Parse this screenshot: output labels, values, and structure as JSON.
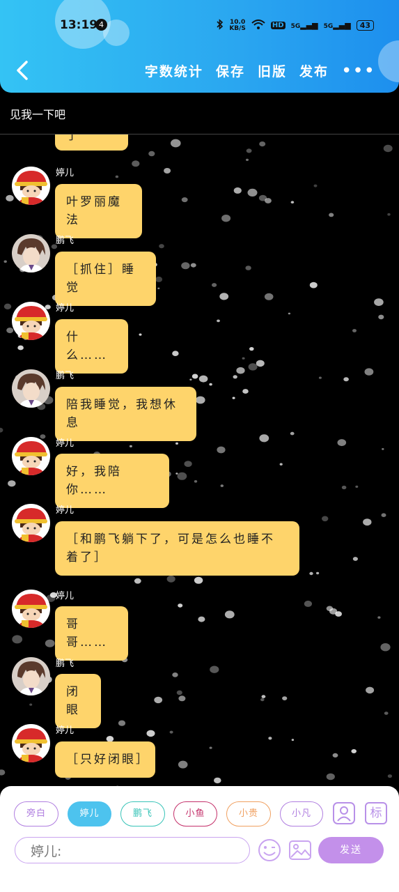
{
  "status_bar": {
    "time": "13:19",
    "notification_count": "4",
    "network_speed": "10.0\nKB/S",
    "hd_label": "HD",
    "signal_1": "5G",
    "signal_2": "5G",
    "battery": "43"
  },
  "header": {
    "actions": [
      "字数统计",
      "保存",
      "旧版",
      "发布"
    ],
    "more": "•••"
  },
  "title": "见我一下吧",
  "messages": [
    {
      "sender": "",
      "text": "别管我了",
      "avatar": "tinger"
    },
    {
      "sender": "婷儿",
      "text": "叶罗丽魔法",
      "avatar": "tinger"
    },
    {
      "sender": "鹏飞",
      "text": "［抓住］睡觉",
      "avatar": "pengfei"
    },
    {
      "sender": "婷儿",
      "text": "什么……",
      "avatar": "tinger"
    },
    {
      "sender": "鹏飞",
      "text": "陪我睡觉，我想休息",
      "avatar": "pengfei"
    },
    {
      "sender": "婷儿",
      "text": "好，我陪你……",
      "avatar": "tinger"
    },
    {
      "sender": "婷儿",
      "text": "［和鹏飞躺下了，可是怎么也睡不着了］",
      "avatar": "tinger"
    },
    {
      "sender": "婷儿",
      "text": "哥哥……",
      "avatar": "tinger"
    },
    {
      "sender": "鹏飞",
      "text": "闭眼",
      "avatar": "pengfei"
    },
    {
      "sender": "婷儿",
      "text": "［只好闭眼］",
      "avatar": "tinger"
    }
  ],
  "roles": [
    {
      "label": "旁白",
      "color": "#b07ee0",
      "active": false
    },
    {
      "label": "婷儿",
      "color": "#4dc3ee",
      "active": true
    },
    {
      "label": "鹏飞",
      "color": "#38c4b8",
      "active": false
    },
    {
      "label": "小鱼",
      "color": "#c4306a",
      "active": false
    },
    {
      "label": "小贵",
      "color": "#f0a060",
      "active": false
    },
    {
      "label": "小凡",
      "color": "#b07ee0",
      "active": false
    }
  ],
  "icons": {
    "add_role": "add-person-icon",
    "tag": "标",
    "emoji": "emoji-icon",
    "image": "image-icon"
  },
  "input": {
    "value": "婷儿:"
  },
  "send_label": "发送",
  "colors": {
    "header": "#2aa6f0",
    "bubble": "#fed46b",
    "send": "#c390ea",
    "accent": "#c9a4f0"
  }
}
